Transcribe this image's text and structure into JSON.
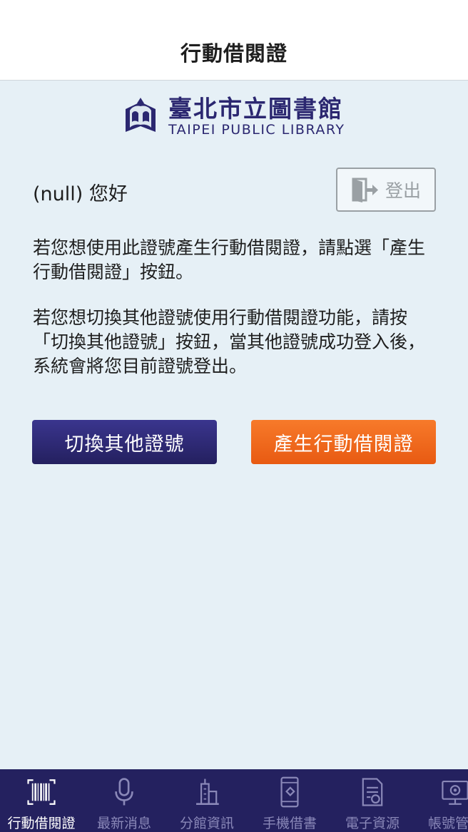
{
  "header": {
    "title": "行動借閱證"
  },
  "logo": {
    "name_zh": "臺北市立圖書館",
    "name_en": "TAIPEI PUBLIC LIBRARY"
  },
  "greeting": "(null) 您好",
  "logout": {
    "label": "登出"
  },
  "instructions": {
    "p1": "若您想使用此證號產生行動借閱證，請點選「產生行動借閱證」按鈕。",
    "p2": "若您想切換其他證號使用行動借閱證功能，請按「切換其他證號」按鈕，當其他證號成功登入後，系統會將您目前證號登出。"
  },
  "buttons": {
    "switch": "切換其他證號",
    "generate": "產生行動借閱證"
  },
  "nav": [
    {
      "label": "行動借閱證",
      "icon": "barcode-icon",
      "active": true
    },
    {
      "label": "最新消息",
      "icon": "microphone-icon",
      "active": false
    },
    {
      "label": "分館資訊",
      "icon": "building-icon",
      "active": false
    },
    {
      "label": "手機借書",
      "icon": "phone-icon",
      "active": false
    },
    {
      "label": "電子資源",
      "icon": "document-icon",
      "active": false
    },
    {
      "label": "帳號管理",
      "icon": "monitor-gear-icon",
      "active": false
    }
  ],
  "colors": {
    "brand": "#2b2770",
    "switch_button": "#2e2a77",
    "generate_button": "#f06a1e",
    "nav_bg": "#24215f",
    "page_bg": "#e6f0f6"
  }
}
